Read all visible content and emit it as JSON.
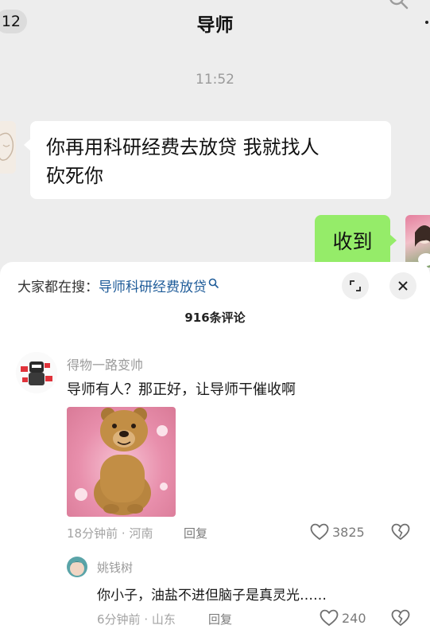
{
  "chat": {
    "back_badge": "12",
    "title": "导师",
    "time": "11:52",
    "messages": [
      {
        "side": "left",
        "line1": "你再用科研经费去放贷 我就找人",
        "line2": "砍死你"
      },
      {
        "side": "right",
        "text": "收到"
      }
    ]
  },
  "sheet": {
    "search_prefix": "大家都在搜：",
    "search_term": "导师科研经费放贷",
    "comment_count": "916条评论",
    "comment": {
      "user": "得物一路变帅",
      "text": "导师有人？那正好，让导师干催收啊",
      "time": "18分钟前",
      "location": "河南",
      "reply_label": "回复",
      "likes": "3825"
    },
    "reply": {
      "user": "姚钱树",
      "text": "你小子，油盐不进但脑子是真灵光……",
      "time": "6分钟前",
      "location": "山东",
      "reply_label": "回复",
      "likes": "240"
    }
  },
  "icons": {
    "search": "search-icon",
    "expand": "expand-icon",
    "close": "close-icon",
    "like": "heart-icon",
    "dislike": "broken-heart-icon"
  },
  "colors": {
    "chat_background": "#ededed",
    "incoming_bubble": "#ffffff",
    "outgoing_bubble": "#95ec69",
    "search_link": "#1f5c99"
  }
}
